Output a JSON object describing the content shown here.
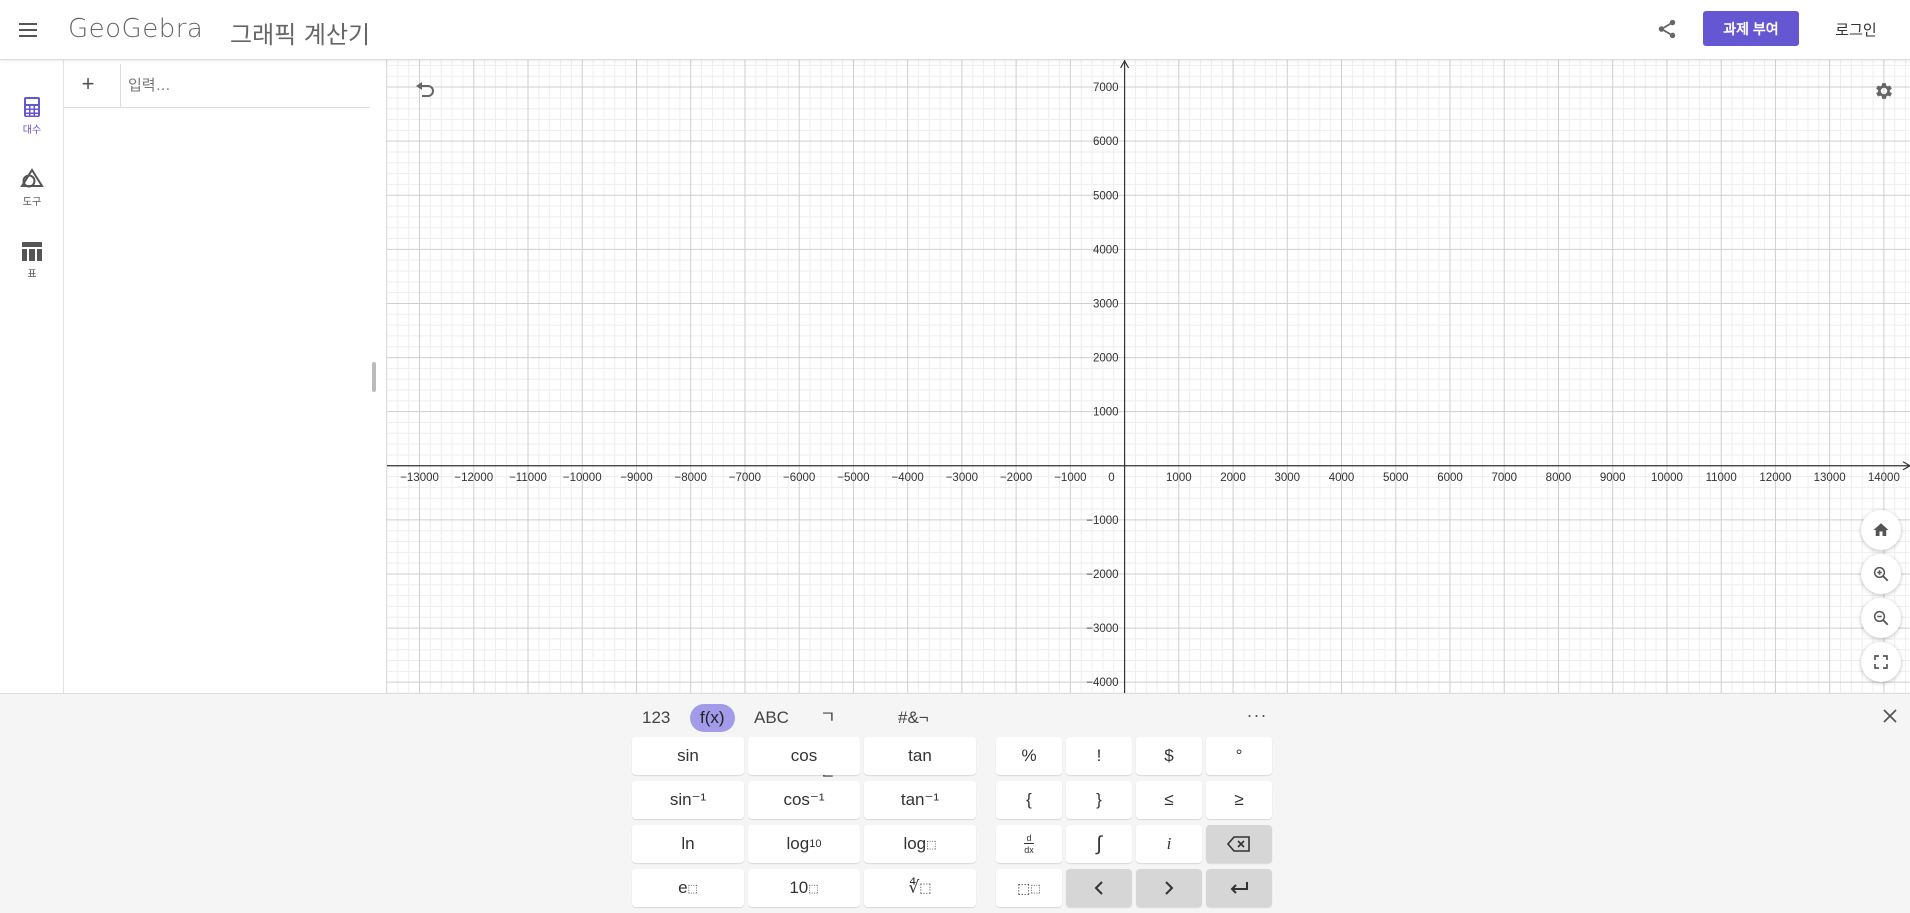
{
  "header": {
    "brand": "GeoGebra",
    "app_title": "그래픽 계산기",
    "assign_label": "과제 부여",
    "login_label": "로그인",
    "accent_color": "#6557d2"
  },
  "rail": {
    "items": [
      {
        "label": "대수",
        "icon": "calculator-icon",
        "active": true
      },
      {
        "label": "도구",
        "icon": "shapes-icon",
        "active": false
      },
      {
        "label": "표",
        "icon": "table-icon",
        "active": false
      }
    ]
  },
  "algebra": {
    "input_placeholder": "입력…"
  },
  "graph": {
    "x_ticks": [
      "−13000",
      "−12000",
      "−11000",
      "−10000",
      "−9000",
      "−8000",
      "−7000",
      "−6000",
      "−5000",
      "−4000",
      "−3000",
      "−2000",
      "−1000",
      "0",
      "1000",
      "2000",
      "3000",
      "4000",
      "5000",
      "6000",
      "7000",
      "8000",
      "9000",
      "10000",
      "11000",
      "12000",
      "13000",
      "14000"
    ],
    "y_ticks_pos": [
      "7000",
      "6000",
      "5000",
      "4000",
      "3000",
      "2000",
      "1000"
    ],
    "y_ticks_neg": [
      "−1000",
      "−2000",
      "−3000",
      "−4000"
    ],
    "x_range": [
      -13600,
      14500
    ],
    "y_range": [
      -4200,
      7500
    ],
    "grid": true
  },
  "keyboard": {
    "tabs": [
      {
        "label": "123",
        "active": false
      },
      {
        "label": "f(x)",
        "active": true
      },
      {
        "label": "ABC",
        "active": false
      },
      {
        "label": "ㄱㄴㄷ",
        "active": false
      },
      {
        "label": "#&¬",
        "active": false
      }
    ],
    "more_label": "···",
    "functions": {
      "sin": "sin",
      "cos": "cos",
      "tan": "tan",
      "asin": "sin⁻¹",
      "acos": "cos⁻¹",
      "atan": "tan⁻¹",
      "ln": "ln",
      "log10_base": "log",
      "log10_sub": "10",
      "logb": "log",
      "exp_base": "e",
      "pow10_base": "10",
      "root_sym": "∜"
    },
    "symbols": {
      "percent": "%",
      "factorial": "!",
      "dollar": "$",
      "degree": "°",
      "lbrace": "{",
      "rbrace": "}",
      "le": "≤",
      "ge": "≥",
      "deriv_top": "d",
      "deriv_bot": "dx",
      "integral": "∫",
      "imag": "i"
    }
  }
}
